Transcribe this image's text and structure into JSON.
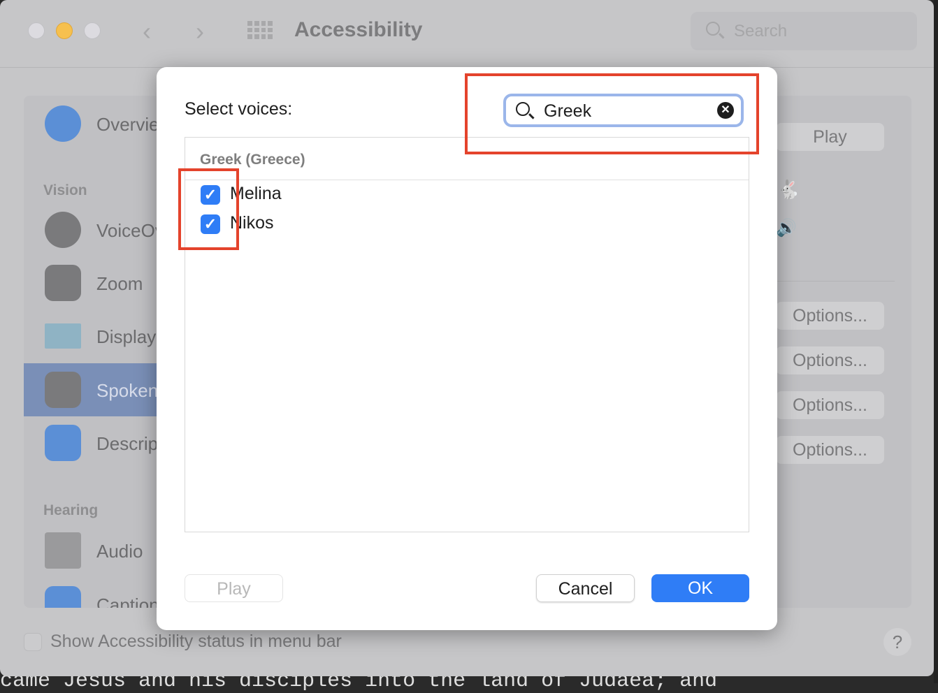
{
  "background_text": "came Jesus and his disciples into the land of Judaea; and",
  "window": {
    "title": "Accessibility",
    "search_placeholder": "Search"
  },
  "sidebar": {
    "items": [
      {
        "label": "Overview",
        "section": ""
      },
      {
        "label": "VoiceOver",
        "section": "Vision"
      },
      {
        "label": "Zoom",
        "section": "Vision"
      },
      {
        "label": "Display",
        "section": "Vision"
      },
      {
        "label": "Spoken Content",
        "section": "Vision",
        "selected": true
      },
      {
        "label": "Descriptions",
        "section": "Vision"
      },
      {
        "label": "Audio",
        "section": "Hearing"
      },
      {
        "label": "Captions",
        "section": "Hearing"
      }
    ],
    "sections": [
      "Vision",
      "Hearing"
    ]
  },
  "right_panel": {
    "play_label": "Play",
    "options_labels": [
      "Options...",
      "Options...",
      "Options...",
      "Options..."
    ]
  },
  "footer": {
    "show_status_label": "Show Accessibility status in menu bar",
    "show_status_checked": false,
    "help_label": "?"
  },
  "dialog": {
    "label": "Select voices:",
    "search_value": "Greek",
    "group": "Greek (Greece)",
    "voices": [
      {
        "name": "Melina",
        "checked": true
      },
      {
        "name": "Nikos",
        "checked": true
      }
    ],
    "play_label": "Play",
    "cancel_label": "Cancel",
    "ok_label": "OK"
  },
  "colors": {
    "accent": "#2f7df6",
    "highlight": "#e4432c",
    "selection": "#7a8fb7"
  }
}
